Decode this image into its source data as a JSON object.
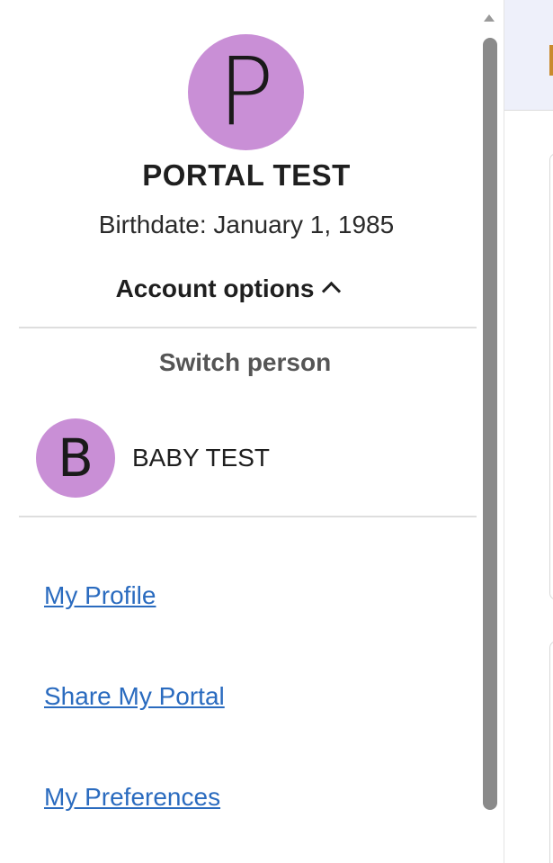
{
  "profile": {
    "avatar_initial": "P",
    "name": "PORTAL TEST",
    "birthdate": "Birthdate: January 1, 1985",
    "account_options_label": "Account options"
  },
  "switch_person": {
    "heading": "Switch person",
    "people": [
      {
        "initial": "B",
        "name": "BABY TEST"
      }
    ]
  },
  "links": {
    "my_profile": "My Profile",
    "share_my_portal": "Share My Portal",
    "my_preferences": "My Preferences"
  },
  "colors": {
    "avatar": "#c98fd6",
    "link": "#2a6bbf",
    "header_bg": "#eef0fa"
  },
  "icons": {
    "account_options_toggle": "chevron-up-icon",
    "scroll_up": "scroll-up-arrow-icon"
  }
}
